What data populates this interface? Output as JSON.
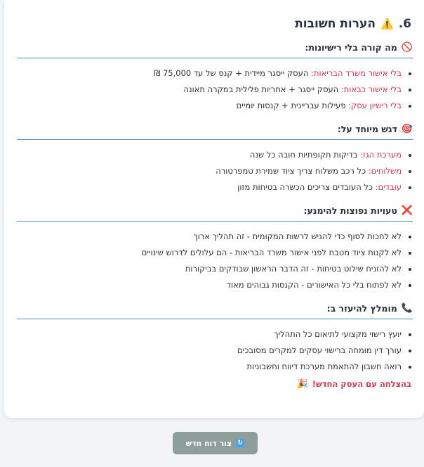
{
  "title": {
    "number": "6.",
    "text": "הערות חשובות",
    "icon": "warning-icon"
  },
  "sections": [
    {
      "heading": "מה קורה בלי רישיונות:",
      "icon": "no-entry-icon",
      "items": [
        {
          "label": "בלי אישור משרד הבריאות:",
          "text": " העסק ייסגר מיידית + קנס של עד 75,000 ₪"
        },
        {
          "label": "בלי אישור כבאות:",
          "text": " העסק ייסגר + אחריות פלילית במקרה תאונה"
        },
        {
          "label": "בלי רישיון עסק:",
          "text": " פעילות עבריינית + קנסות יומיים"
        }
      ]
    },
    {
      "heading": "דגש מיוחד על:",
      "icon": "target-icon",
      "items": [
        {
          "label": "מערכת הגז:",
          "text": " בדיקות תקופתיות חובה כל שנה"
        },
        {
          "label": "משלוחים:",
          "text": " כל רכב משלוח צריך ציוד שמירת טמפרטורה"
        },
        {
          "label": "עובדים:",
          "text": " כל העובדים צריכים הכשרה בטיחות מזון"
        }
      ]
    },
    {
      "heading": "טעויות נפוצות להימנע:",
      "icon": "cross-mark-icon",
      "items": [
        {
          "label": "",
          "text": "לא לחכות לסוף כדי להגיש לרשות המקומית - זה תהליך ארוך"
        },
        {
          "label": "",
          "text": "לא לקנות ציוד מטבח לפני אישור משרד הבריאות - הם עלולים לדרוש שינויים"
        },
        {
          "label": "",
          "text": "לא להזניח שילוט בטיחות - זה הדבר הראשון שבודקים בביקורות"
        },
        {
          "label": "",
          "text": "לא לפתוח בלי כל האישורים - הקנסות גבוהים מאוד"
        }
      ]
    },
    {
      "heading": "מומלץ להיעזר ב:",
      "icon": "phone-icon",
      "items": [
        {
          "label": "",
          "text": "יועץ רישוי מקצועי לתיאום כל התהליך"
        },
        {
          "label": "",
          "text": "עורך דין מומחה ברישוי עסקים למקרים מסובכים"
        },
        {
          "label": "",
          "text": "רואה חשבון להתאמת מערכת דיווח וחשבוניות"
        }
      ]
    }
  ],
  "closing": {
    "text": "בהצלחה עם העסק החדש!",
    "icon": "party-popper-icon"
  },
  "new_report_button": {
    "label": "צור דוח חדש",
    "icon": "refresh-icon"
  },
  "colors": {
    "accent": "#d6334e",
    "divider": "#4e8fa6",
    "button": "#8e9e9b"
  }
}
